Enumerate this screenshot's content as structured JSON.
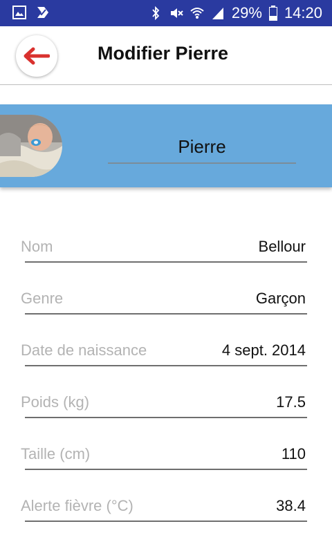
{
  "statusbar": {
    "battery": "29%",
    "time": "14:20",
    "colors": {
      "bg": "#2a3aa0"
    }
  },
  "toolbar": {
    "title": "Modifier Pierre",
    "back_icon": "arrow-left-icon"
  },
  "profile": {
    "first_name": "Pierre",
    "band_color": "#67a9dc"
  },
  "form": {
    "rows": [
      {
        "label": "Nom",
        "value": "Bellour"
      },
      {
        "label": "Genre",
        "value": "Garçon"
      },
      {
        "label": "Date de naissance",
        "value": "4 sept. 2014"
      },
      {
        "label": "Poids (kg)",
        "value": "17.5"
      },
      {
        "label": "Taille (cm)",
        "value": "110"
      },
      {
        "label": "Alerte fièvre (°C)",
        "value": "38.4"
      }
    ]
  }
}
